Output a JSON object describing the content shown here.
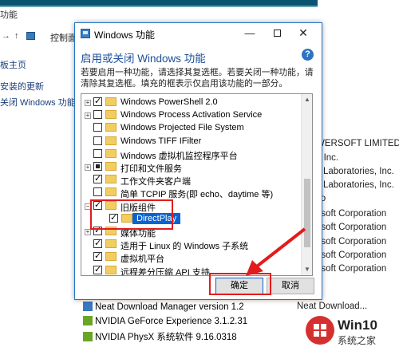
{
  "background": {
    "window_title": "功能",
    "breadcrumb": "控制面",
    "sidebar": [
      "板主页",
      "安装的更新",
      "关闭 Windows 功能"
    ],
    "publishers": [
      "WERSOFT LIMITED",
      "e Inc.",
      "y Laboratories, Inc.",
      "y Laboratories, Inc.",
      "vo",
      "osoft Corporation",
      "osoft Corporation",
      "osoft Corporation",
      "osoft Corporation",
      "osoft Corporation",
      "Neat Download..."
    ],
    "programs": [
      {
        "name": "Neat Download Manager version 1.2",
        "icon_color": "#3a78c0"
      },
      {
        "name": "NVIDIA GeForce Experience 3.1.2.31",
        "icon_color": "#6aa525"
      },
      {
        "name": "NVIDIA PhysX 系统软件 9.16.0318",
        "icon_color": "#6aa525"
      }
    ]
  },
  "dialog": {
    "title": "Windows 功能",
    "minimize": "—",
    "close": "✕",
    "heading": "启用或关闭 Windows 功能",
    "help": "?",
    "description": "若要启用一种功能，请选择其复选框。若要关闭一种功能，请清除其复选框。填充的框表示仅启用该功能的一部分。",
    "features": [
      {
        "label": "Windows PowerShell 2.0",
        "expander": "+",
        "state": "checked",
        "indent": 0
      },
      {
        "label": "Windows Process Activation Service",
        "expander": "+",
        "state": "unchecked",
        "indent": 0
      },
      {
        "label": "Windows Projected File System",
        "expander": "",
        "state": "unchecked",
        "indent": 0
      },
      {
        "label": "Windows TIFF IFilter",
        "expander": "",
        "state": "unchecked",
        "indent": 0
      },
      {
        "label": "Windows 虚拟机监控程序平台",
        "expander": "",
        "state": "unchecked",
        "indent": 0
      },
      {
        "label": "打印和文件服务",
        "expander": "+",
        "state": "partial",
        "indent": 0
      },
      {
        "label": "工作文件夹客户端",
        "expander": "",
        "state": "checked",
        "indent": 0
      },
      {
        "label": "简单 TCPIP 服务(即 echo、daytime 等)",
        "expander": "",
        "state": "unchecked",
        "indent": 0
      },
      {
        "label": "旧版组件",
        "expander": "−",
        "state": "checked",
        "indent": 0
      },
      {
        "label": "DirectPlay",
        "expander": "",
        "state": "checked",
        "indent": 1,
        "selected": true
      },
      {
        "label": "媒体功能",
        "expander": "+",
        "state": "checked",
        "indent": 0
      },
      {
        "label": "适用于 Linux 的 Windows 子系统",
        "expander": "",
        "state": "checked",
        "indent": 0
      },
      {
        "label": "虚拟机平台",
        "expander": "",
        "state": "checked",
        "indent": 0
      },
      {
        "label": "远程差分压缩 API 支持",
        "expander": "",
        "state": "checked",
        "indent": 0
      }
    ],
    "ok_label": "确定",
    "cancel_label": "取消"
  },
  "watermark": {
    "name": "Win10",
    "sub": "系统之家"
  },
  "colors": {
    "accent": "#0a63d1",
    "heading": "#1c4f9a",
    "annotation": "#e21c1c",
    "folder": "#f2cd62"
  }
}
